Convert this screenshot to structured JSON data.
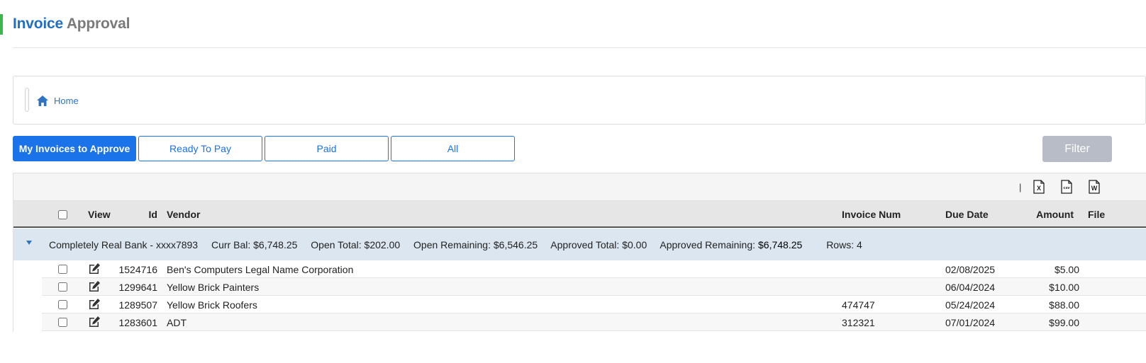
{
  "header": {
    "title_part1": "Invoice",
    "title_part2": "Approval"
  },
  "breadcrumb": {
    "home_label": "Home"
  },
  "tabs": [
    {
      "label": "My Invoices to Approve",
      "active": true
    },
    {
      "label": "Ready To Pay",
      "active": false
    },
    {
      "label": "Paid",
      "active": false
    },
    {
      "label": "All",
      "active": false
    }
  ],
  "filter": {
    "label": "Filter"
  },
  "toolbar": {
    "separator": "|",
    "export_icons": [
      "excel-export-icon",
      "csv-export-icon",
      "word-export-icon"
    ],
    "excel_letter": "X",
    "csv_letters": "csv",
    "word_letter": "W"
  },
  "columns": {
    "view": "View",
    "id": "Id",
    "vendor": "Vendor",
    "invoice_num": "Invoice Num",
    "due_date": "Due Date",
    "amount": "Amount",
    "file": "File"
  },
  "group": {
    "account": "Completely Real Bank - xxxx7893",
    "curr_bal": "Curr Bal: $6,748.25",
    "open_total": "Open Total: $202.00",
    "open_remaining": "Open Remaining: $6,546.25",
    "approved_total": "Approved Total: $0.00",
    "approved_remaining_label": "Approved Remaining:",
    "approved_remaining_value": "$6,748.25",
    "rows": "Rows: 4"
  },
  "rows": [
    {
      "id": "1524716",
      "vendor": "Ben's Computers Legal Name Corporation",
      "invoice_num": "",
      "due_date": "02/08/2025",
      "amount": "$5.00"
    },
    {
      "id": "1299641",
      "vendor": "Yellow Brick Painters",
      "invoice_num": "",
      "due_date": "06/04/2024",
      "amount": "$10.00"
    },
    {
      "id": "1289507",
      "vendor": "Yellow Brick Roofers",
      "invoice_num": "474747",
      "due_date": "05/24/2024",
      "amount": "$88.00"
    },
    {
      "id": "1283601",
      "vendor": "ADT",
      "invoice_num": "312321",
      "due_date": "07/01/2024",
      "amount": "$99.00"
    }
  ],
  "colors": {
    "accent": "#3cb54a",
    "primary": "#1a73e8",
    "title_blue": "#1f6fc5",
    "title_gray": "#7a7a7a",
    "group_bg": "#dce6f0",
    "filter_bg": "#b7bcc6"
  }
}
